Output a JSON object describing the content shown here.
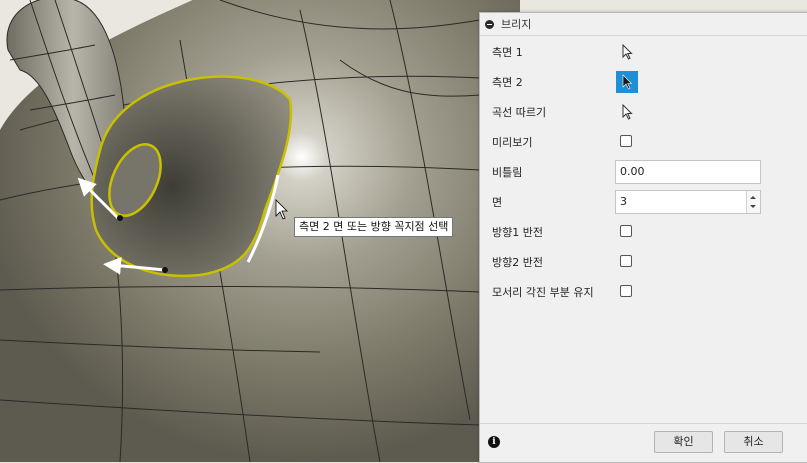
{
  "tooltip": "측면 2 면 또는 방향 꼭지점 선택",
  "panel": {
    "title": "브리지",
    "rows": [
      {
        "label": "측면 1",
        "control": "select",
        "active": false
      },
      {
        "label": "측면 2",
        "control": "select",
        "active": true
      },
      {
        "label": "곡선 따르기",
        "control": "select",
        "active": false
      },
      {
        "label": "미리보기",
        "control": "checkbox",
        "checked": false
      },
      {
        "label": "비틀림",
        "control": "text",
        "value": "0.00"
      },
      {
        "label": "면",
        "control": "spinner",
        "value": "3"
      },
      {
        "label": "방향1 반전",
        "control": "checkbox",
        "checked": false
      },
      {
        "label": "방향2 반전",
        "control": "checkbox",
        "checked": false
      },
      {
        "label": "모서리 각진 부분 유지",
        "control": "checkbox",
        "checked": false
      }
    ],
    "ok_label": "확인",
    "cancel_label": "취소",
    "info_icon": "i"
  },
  "colors": {
    "accent": "#1e8fd6",
    "selection_highlight": "#c8c000",
    "model_surface": "#8a8778",
    "panel_bg": "#f0f0f0"
  }
}
